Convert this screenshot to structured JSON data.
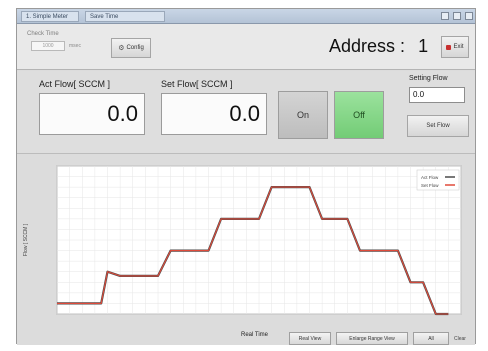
{
  "window": {
    "tabs": [
      "1. Simple Meter",
      "Save Time"
    ]
  },
  "toolbar": {
    "check_time_label": "Check Time",
    "check_time_value": "1000",
    "check_time_unit": "msec",
    "config_label": "Config",
    "address_label": "Address :",
    "address_value": "1",
    "exit_label": "Exit"
  },
  "flow": {
    "act_label": "Act Flow[ SCCM ]",
    "act_value": "0.0",
    "set_label": "Set Flow[ SCCM ]",
    "set_value": "0.0",
    "on_label": "On",
    "off_label": "Off",
    "setting_label": "Setting Flow",
    "setting_value": "0.0",
    "set_flow_button": "Set Flow"
  },
  "chart_bottom": {
    "xlabel": "Real Time",
    "real_view": "Real View",
    "enlarge_view": "Enlarge Range View",
    "all": "All",
    "clear": "Clear"
  },
  "colors": {
    "off_button": "#7ed27f",
    "act_series": "#4a4a4a",
    "set_series": "#e04a3a"
  },
  "chart_data": {
    "type": "line",
    "ylabel": "Flow [ SCCM ]",
    "xlabel": "Real Time",
    "x": [
      0,
      4,
      7,
      8,
      10,
      16,
      18,
      24,
      26,
      32,
      34,
      40,
      42,
      46,
      48,
      54,
      56,
      58,
      60,
      62
    ],
    "series": [
      {
        "name": "Act Flow",
        "values": [
          5,
          5,
          5,
          20,
          18,
          18,
          30,
          30,
          45,
          45,
          60,
          60,
          45,
          45,
          30,
          30,
          15,
          15,
          0,
          0
        ]
      },
      {
        "name": "Set Flow",
        "values": [
          5,
          5,
          5,
          20,
          18,
          18,
          30,
          30,
          45,
          45,
          60,
          60,
          45,
          45,
          30,
          30,
          15,
          15,
          0,
          0
        ]
      }
    ],
    "ylim": [
      0,
      70
    ],
    "xlim": [
      0,
      64
    ],
    "grid": true,
    "legend": "top-right"
  }
}
